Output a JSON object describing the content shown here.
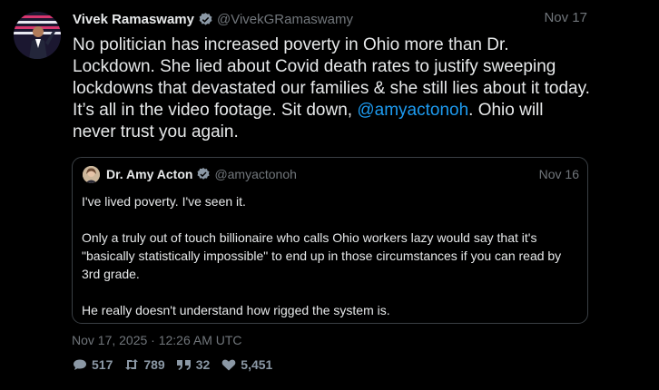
{
  "tweet": {
    "author_name": "Vivek Ramaswamy",
    "author_handle": "@VivekGRamaswamy",
    "date": "Nov 17",
    "text_before": "No politician has increased poverty in Ohio more than Dr. Lockdown. She lied about Covid death rates to justify sweeping lockdowns that devastated our families & she still lies about it today. It’s all in the video footage. Sit down, ",
    "mention": "@amyactonoh",
    "text_after": ". Ohio will never trust you again.",
    "timestamp": "Nov 17, 2025 · 12:26 AM UTC"
  },
  "quote": {
    "author_name": "Dr. Amy Acton",
    "author_handle": "@amyactonoh",
    "date": "Nov 16",
    "paragraphs": [
      "I've lived poverty. I've seen it.",
      "Only a truly out of touch billionaire who calls Ohio workers lazy would say that it's \"basically statistically impossible\" to end up in those circumstances if you can read by 3rd grade.",
      "He really doesn't understand how rigged the system is."
    ]
  },
  "stats": {
    "replies": "517",
    "retweets": "789",
    "quotes": "32",
    "likes": "5,451"
  },
  "icons": {
    "verified": "verified-badge-icon",
    "reply": "comment-icon",
    "retweet": "retweet-icon",
    "quote": "quote-icon",
    "like": "heart-icon"
  },
  "colors": {
    "background": "#000000",
    "text": "#e7e9ea",
    "muted": "#71767b",
    "accent": "#1d9bf0"
  }
}
